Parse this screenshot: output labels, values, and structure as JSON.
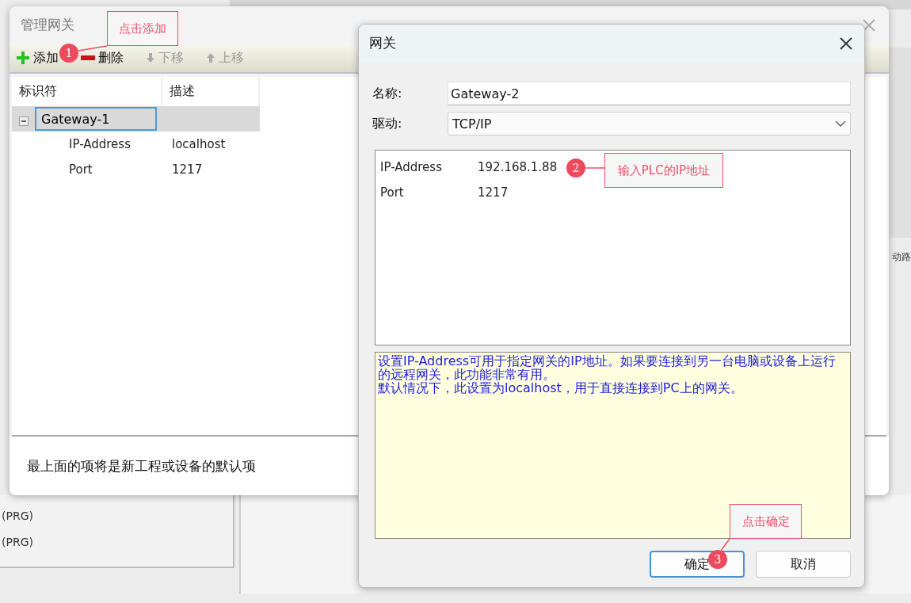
{
  "background_app": {
    "left_items": [
      "(PRG)",
      "(PRG)"
    ],
    "right_fragment": "动路"
  },
  "manage_dialog": {
    "title": "管理网关",
    "toolbar": [
      {
        "label": "添加",
        "kind": "add",
        "disabled": false
      },
      {
        "label": "删除",
        "kind": "remove",
        "disabled": false
      },
      {
        "label": "下移",
        "kind": "down",
        "disabled": true
      },
      {
        "label": "上移",
        "kind": "up",
        "disabled": true
      }
    ],
    "tree": {
      "columns": [
        "标识符",
        "描述"
      ],
      "items": [
        {
          "identifier": "Gateway-1",
          "expanded": true,
          "selected": true,
          "children": [
            {
              "identifier": "IP-Address",
              "description": "localhost"
            },
            {
              "identifier": "Port",
              "description": "1217"
            }
          ]
        }
      ]
    },
    "footer": "最上面的项将是新工程或设备的默认项"
  },
  "gateway_dialog": {
    "title": "网关",
    "fields": [
      {
        "label": "名称:",
        "value": "Gateway-2",
        "kind": "text"
      },
      {
        "label": "驱动:",
        "value": "TCP/IP",
        "kind": "select"
      }
    ],
    "params": [
      {
        "name": "IP-Address",
        "value": "192.168.1.88"
      },
      {
        "name": "Port",
        "value": "1217"
      }
    ],
    "help": [
      "设置IP-Address可用于指定网关的IP地址。如果要连接到另一台电脑或设备上运行的远程网关，此功能非常有用。",
      "默认情况下，此设置为localhost，用于直接连接到PC上的网关。"
    ],
    "buttons": [
      {
        "label": "确定",
        "default": true
      },
      {
        "label": "取消",
        "default": false
      }
    ]
  },
  "annotations": [
    {
      "number": "1",
      "text": "点击添加"
    },
    {
      "number": "2",
      "text": "输入PLC的IP地址"
    },
    {
      "number": "3",
      "text": "点击确定"
    }
  ]
}
